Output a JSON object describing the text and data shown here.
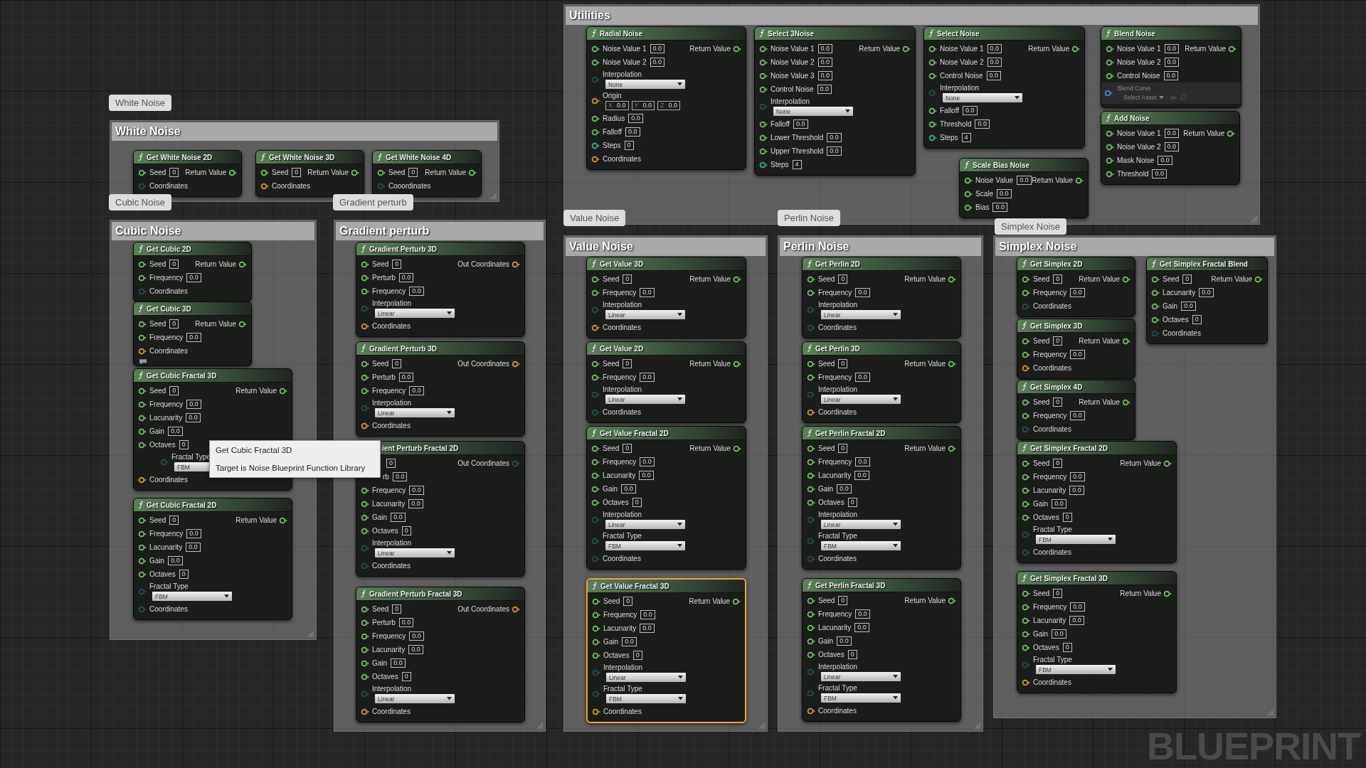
{
  "comments": [
    {
      "title": "Utilities",
      "nodes": [
        {
          "title": "Radial Noise",
          "selected": false,
          "output": {
            "label": "Return Value",
            "color": "#74c465"
          },
          "pins": [
            {
              "kind": "value",
              "label": "Noise Value 1",
              "value": "0.0",
              "color": "#74c465"
            },
            {
              "kind": "value",
              "label": "Noise Value 2",
              "value": "0.0",
              "color": "#74c465"
            },
            {
              "kind": "enum",
              "label": "Interpolation",
              "value": "None",
              "color": "#27504c"
            },
            {
              "kind": "vector",
              "label": "Origin",
              "color": "#d99a2b",
              "fields": [
                {
                  "axis": "X",
                  "value": "0.0"
                },
                {
                  "axis": "Y",
                  "value": "0.0"
                },
                {
                  "axis": "Z",
                  "value": "0.0"
                }
              ]
            },
            {
              "kind": "value",
              "label": "Radius",
              "value": "0.0",
              "color": "#74c465"
            },
            {
              "kind": "value",
              "label": "Falloff",
              "value": "0.0",
              "color": "#74c465"
            },
            {
              "kind": "value",
              "label": "Steps",
              "value": "0",
              "color": "#2fb3a3"
            },
            {
              "kind": "plain",
              "label": "Coordinates",
              "color": "#d99a2b"
            }
          ]
        },
        {
          "title": "Select 3Noise",
          "selected": false,
          "output": {
            "label": "Return Value",
            "color": "#74c465"
          },
          "pins": [
            {
              "kind": "value",
              "label": "Noise Value 1",
              "value": "0.0",
              "color": "#74c465"
            },
            {
              "kind": "value",
              "label": "Noise Value 2",
              "value": "0.0",
              "color": "#74c465"
            },
            {
              "kind": "value",
              "label": "Noise Value 3",
              "value": "0.0",
              "color": "#74c465"
            },
            {
              "kind": "value",
              "label": "Control Noise",
              "value": "0.0",
              "color": "#74c465"
            },
            {
              "kind": "enum",
              "label": "Interpolation",
              "value": "None",
              "color": "#27504c"
            },
            {
              "kind": "value",
              "label": "Falloff",
              "value": "0.0",
              "color": "#74c465"
            },
            {
              "kind": "value",
              "label": "Lower Threshold",
              "value": "0.0",
              "color": "#74c465"
            },
            {
              "kind": "value",
              "label": "Upper Threshold",
              "value": "0.0",
              "color": "#74c465"
            },
            {
              "kind": "value",
              "label": "Steps",
              "value": "4",
              "color": "#2fb3a3"
            }
          ]
        },
        {
          "title": "Select Noise",
          "selected": false,
          "output": {
            "label": "Return Value",
            "color": "#74c465"
          },
          "pins": [
            {
              "kind": "value",
              "label": "Noise Value 1",
              "value": "0.0",
              "color": "#74c465"
            },
            {
              "kind": "value",
              "label": "Noise Value 2",
              "value": "0.0",
              "color": "#74c465"
            },
            {
              "kind": "value",
              "label": "Control Noise",
              "value": "0.0",
              "color": "#74c465"
            },
            {
              "kind": "enum",
              "label": "Interpolation",
              "value": "None",
              "color": "#27504c"
            },
            {
              "kind": "value",
              "label": "Falloff",
              "value": "0.0",
              "color": "#74c465"
            },
            {
              "kind": "value",
              "label": "Threshold",
              "value": "0.0",
              "color": "#74c465"
            },
            {
              "kind": "value",
              "label": "Steps",
              "value": "4",
              "color": "#2fb3a3"
            }
          ]
        },
        {
          "title": "Blend Noise",
          "selected": false,
          "output": {
            "label": "Return Value",
            "color": "#74c465"
          },
          "pins": [
            {
              "kind": "value",
              "label": "Noise Value 1",
              "value": "0.0",
              "color": "#74c465"
            },
            {
              "kind": "value",
              "label": "Noise Value 2",
              "value": "0.0",
              "color": "#74c465"
            },
            {
              "kind": "value",
              "label": "Control Noise",
              "value": "0.0",
              "color": "#74c465"
            },
            {
              "kind": "asset",
              "label": "Blend Curve",
              "placeholder": "Select Asset",
              "color": "#3a8ee6"
            }
          ]
        },
        {
          "title": "Add Noise",
          "selected": false,
          "output": {
            "label": "Return Value",
            "color": "#74c465"
          },
          "pins": [
            {
              "kind": "value",
              "label": "Noise Value 1",
              "value": "0.0",
              "color": "#74c465"
            },
            {
              "kind": "value",
              "label": "Noise Value 2",
              "value": "0.0",
              "color": "#74c465"
            },
            {
              "kind": "value",
              "label": "Mask Noise",
              "value": "0.0",
              "color": "#74c465"
            },
            {
              "kind": "value",
              "label": "Threshold",
              "value": "0.0",
              "color": "#74c465"
            }
          ]
        },
        {
          "title": "Scale Bias Noise",
          "selected": false,
          "output": {
            "label": "Return Value",
            "color": "#74c465"
          },
          "pins": [
            {
              "kind": "value",
              "label": "Noise Value",
              "value": "0.0",
              "color": "#74c465"
            },
            {
              "kind": "value",
              "label": "Scale",
              "value": "0.0",
              "color": "#74c465"
            },
            {
              "kind": "value",
              "label": "Bias",
              "value": "0.0",
              "color": "#74c465"
            }
          ]
        }
      ]
    },
    {
      "title": "White Noise",
      "bubble": "White Noise",
      "nodes": [
        {
          "title": "Get White Noise 2D",
          "selected": false,
          "output": {
            "label": "Return Value",
            "color": "#74c465"
          },
          "pins": [
            {
              "kind": "value",
              "label": "Seed",
              "value": "0",
              "color": "#74c465"
            },
            {
              "kind": "plain",
              "label": "Coordinates",
              "color": "#27504c"
            }
          ]
        },
        {
          "title": "Get White Noise 3D",
          "selected": false,
          "output": {
            "label": "Return Value",
            "color": "#74c465"
          },
          "pins": [
            {
              "kind": "value",
              "label": "Seed",
              "value": "0",
              "color": "#74c465"
            },
            {
              "kind": "plain",
              "label": "Coordinates",
              "color": "#d99a2b"
            }
          ]
        },
        {
          "title": "Get White Noise 4D",
          "selected": false,
          "output": {
            "label": "Return Value",
            "color": "#74c465"
          },
          "pins": [
            {
              "kind": "value",
              "label": "Seed",
              "value": "0",
              "color": "#74c465"
            },
            {
              "kind": "plain",
              "label": "Cooordinates",
              "color": "#27504c"
            }
          ]
        }
      ]
    },
    {
      "title": "Cubic Noise",
      "bubble": "Cubic Noise",
      "nodes": [
        {
          "title": "Get Cubic 2D",
          "selected": false,
          "output": {
            "label": "Return Value",
            "color": "#74c465"
          },
          "pins": [
            {
              "kind": "value",
              "label": "Seed",
              "value": "0",
              "color": "#74c465"
            },
            {
              "kind": "value",
              "label": "Frequency",
              "value": "0.0",
              "color": "#74c465"
            },
            {
              "kind": "plain",
              "label": "Coordinates",
              "color": "#27504c"
            }
          ]
        },
        {
          "title": "Get Cubic 3D",
          "selected": false,
          "comment_bubble": true,
          "output": {
            "label": "Return Value",
            "color": "#74c465"
          },
          "pins": [
            {
              "kind": "value",
              "label": "Seed",
              "value": "0",
              "color": "#74c465"
            },
            {
              "kind": "value",
              "label": "Frequency",
              "value": "0.0",
              "color": "#74c465"
            },
            {
              "kind": "plain",
              "label": "Coordinates",
              "color": "#d99a2b"
            }
          ]
        },
        {
          "title": "Get Cubic Fractal 3D",
          "selected": false,
          "output": {
            "label": "Return Value",
            "color": "#74c465"
          },
          "pins": [
            {
              "kind": "value",
              "label": "Seed",
              "value": "0",
              "color": "#74c465"
            },
            {
              "kind": "value",
              "label": "Frequency",
              "value": "0.0",
              "color": "#74c465"
            },
            {
              "kind": "value",
              "label": "Lacunarity",
              "value": "0.0",
              "color": "#74c465"
            },
            {
              "kind": "value",
              "label": "Gain",
              "value": "0.0",
              "color": "#74c465"
            },
            {
              "kind": "value",
              "label": "Octaves",
              "value": "0",
              "color": "#74c465"
            },
            {
              "kind": "enum",
              "label": "Fractal Type",
              "value": "FBM",
              "color": "#27504c",
              "covered": true
            },
            {
              "kind": "plain",
              "label": "Coordinates",
              "color": "#d99a2b"
            }
          ]
        },
        {
          "title": "Get Cubic Fractal 2D",
          "selected": false,
          "output": {
            "label": "Return Value",
            "color": "#74c465"
          },
          "pins": [
            {
              "kind": "value",
              "label": "Seed",
              "value": "0",
              "color": "#74c465"
            },
            {
              "kind": "value",
              "label": "Frequency",
              "value": "0.0",
              "color": "#74c465"
            },
            {
              "kind": "value",
              "label": "Lacunarity",
              "value": "0.0",
              "color": "#74c465"
            },
            {
              "kind": "value",
              "label": "Gain",
              "value": "0.0",
              "color": "#74c465"
            },
            {
              "kind": "value",
              "label": "Octaves",
              "value": "0",
              "color": "#74c465"
            },
            {
              "kind": "enum",
              "label": "Fractal Type",
              "value": "FBM",
              "color": "#27504c"
            },
            {
              "kind": "plain",
              "label": "Coordinates",
              "color": "#27504c"
            }
          ]
        }
      ]
    },
    {
      "title": "Gradient perturb",
      "bubble": "Gradient perturb",
      "nodes": [
        {
          "title": "Gradient Perturb 3D",
          "selected": false,
          "output": {
            "label": "Out Coordinates",
            "color": "#d99a2b"
          },
          "pins": [
            {
              "kind": "value",
              "label": "Seed",
              "value": "0",
              "color": "#74c465"
            },
            {
              "kind": "value",
              "label": "Perturb",
              "value": "0.0",
              "color": "#74c465"
            },
            {
              "kind": "value",
              "label": "Frequency",
              "value": "0.0",
              "color": "#74c465"
            },
            {
              "kind": "enum",
              "label": "Interpolation",
              "value": "Linear",
              "color": "#27504c"
            },
            {
              "kind": "plain",
              "label": "Coordinates",
              "color": "#d99a2b"
            }
          ]
        },
        {
          "title": "Gradient Perturb 3D",
          "selected": false,
          "output": {
            "label": "Out Coordinates",
            "color": "#d99a2b"
          },
          "pins": [
            {
              "kind": "value",
              "label": "Seed",
              "value": "0",
              "color": "#74c465"
            },
            {
              "kind": "value",
              "label": "Perturb",
              "value": "0.0",
              "color": "#74c465"
            },
            {
              "kind": "value",
              "label": "Frequency",
              "value": "0.0",
              "color": "#74c465"
            },
            {
              "kind": "enum",
              "label": "Interpolation",
              "value": "Linear",
              "color": "#27504c"
            },
            {
              "kind": "plain",
              "label": "Coordinates",
              "color": "#d99a2b"
            }
          ]
        },
        {
          "title": "ient Perturb Fractal 2D",
          "title_covered": true,
          "selected": false,
          "output": {
            "label": "Out Coordinates",
            "color": "#27504c"
          },
          "pins": [
            {
              "kind": "value",
              "value": "0",
              "covered": true
            },
            {
              "kind": "value",
              "label": "rb",
              "value": "0.0",
              "covered": true
            },
            {
              "kind": "value",
              "label": "Frequency",
              "value": "0.0",
              "color": "#74c465"
            },
            {
              "kind": "value",
              "label": "Lacunarity",
              "value": "0.0",
              "color": "#74c465"
            },
            {
              "kind": "value",
              "label": "Gain",
              "value": "0.0",
              "color": "#74c465"
            },
            {
              "kind": "value",
              "label": "Octaves",
              "value": "0",
              "color": "#74c465"
            },
            {
              "kind": "enum",
              "label": "Interpolation",
              "value": "Linear",
              "color": "#27504c"
            },
            {
              "kind": "plain",
              "label": "Coordinates",
              "color": "#27504c"
            }
          ]
        },
        {
          "title": "Gradient Perturb Fractal 3D",
          "selected": false,
          "output": {
            "label": "Out Coordinates",
            "color": "#d99a2b"
          },
          "pins": [
            {
              "kind": "value",
              "label": "Seed",
              "value": "0",
              "color": "#74c465"
            },
            {
              "kind": "value",
              "label": "Perturb",
              "value": "0.0",
              "color": "#74c465"
            },
            {
              "kind": "value",
              "label": "Frequency",
              "value": "0.0",
              "color": "#74c465"
            },
            {
              "kind": "value",
              "label": "Lacunarity",
              "value": "0.0",
              "color": "#74c465"
            },
            {
              "kind": "value",
              "label": "Gain",
              "value": "0.0",
              "color": "#74c465"
            },
            {
              "kind": "value",
              "label": "Octaves",
              "value": "0",
              "color": "#74c465"
            },
            {
              "kind": "enum",
              "label": "Interpolation",
              "value": "Linear",
              "color": "#27504c"
            },
            {
              "kind": "plain",
              "label": "Coordinates",
              "color": "#d99a2b"
            }
          ]
        }
      ]
    },
    {
      "title": "Value Noise",
      "bubble": "Value Noise",
      "nodes": [
        {
          "title": "Get Value 3D",
          "selected": false,
          "output": {
            "label": "Return Value",
            "color": "#74c465"
          },
          "pins": [
            {
              "kind": "value",
              "label": "Seed",
              "value": "0",
              "color": "#74c465"
            },
            {
              "kind": "value",
              "label": "Frequency",
              "value": "0.0",
              "color": "#74c465"
            },
            {
              "kind": "enum",
              "label": "Interpolation",
              "value": "Linear",
              "color": "#27504c"
            },
            {
              "kind": "plain",
              "label": "Coordinates",
              "color": "#d99a2b"
            }
          ]
        },
        {
          "title": "Get Value 2D",
          "selected": false,
          "output": {
            "label": "Return Value",
            "color": "#74c465"
          },
          "pins": [
            {
              "kind": "value",
              "label": "Seed",
              "value": "0",
              "color": "#74c465"
            },
            {
              "kind": "value",
              "label": "Frequency",
              "value": "0.0",
              "color": "#74c465"
            },
            {
              "kind": "enum",
              "label": "Interpolation",
              "value": "Linear",
              "color": "#27504c"
            },
            {
              "kind": "plain",
              "label": "Coordinates",
              "color": "#27504c"
            }
          ]
        },
        {
          "title": "Get Value Fractal 2D",
          "selected": false,
          "output": {
            "label": "Return Value",
            "color": "#74c465"
          },
          "pins": [
            {
              "kind": "value",
              "label": "Seed",
              "value": "0",
              "color": "#74c465"
            },
            {
              "kind": "value",
              "label": "Frequency",
              "value": "0.0",
              "color": "#74c465"
            },
            {
              "kind": "value",
              "label": "Lacunarity",
              "value": "0.0",
              "color": "#74c465"
            },
            {
              "kind": "value",
              "label": "Gain",
              "value": "0.0",
              "color": "#74c465"
            },
            {
              "kind": "value",
              "label": "Octaves",
              "value": "0",
              "color": "#74c465"
            },
            {
              "kind": "enum",
              "label": "Interpolation",
              "value": "Linear",
              "color": "#27504c"
            },
            {
              "kind": "enum",
              "label": "Fractal Type",
              "value": "FBM",
              "color": "#27504c"
            },
            {
              "kind": "plain",
              "label": "Coordinates",
              "color": "#27504c"
            }
          ]
        },
        {
          "title": "Get Value Fractal 3D",
          "selected": true,
          "output": {
            "label": "Return Value",
            "color": "#74c465"
          },
          "pins": [
            {
              "kind": "value",
              "label": "Seed",
              "value": "0",
              "color": "#74c465"
            },
            {
              "kind": "value",
              "label": "Frequency",
              "value": "0.0",
              "color": "#74c465"
            },
            {
              "kind": "value",
              "label": "Lacunarity",
              "value": "0.0",
              "color": "#74c465"
            },
            {
              "kind": "value",
              "label": "Gain",
              "value": "0.0",
              "color": "#74c465"
            },
            {
              "kind": "value",
              "label": "Octaves",
              "value": "0",
              "color": "#74c465"
            },
            {
              "kind": "enum",
              "label": "Interpolation",
              "value": "Linear",
              "color": "#27504c"
            },
            {
              "kind": "enum",
              "label": "Fractal Type",
              "value": "FBM",
              "color": "#27504c"
            },
            {
              "kind": "plain",
              "label": "Coordinates",
              "color": "#d99a2b"
            }
          ]
        }
      ]
    },
    {
      "title": "Perlin Noise",
      "bubble": "Perlin Noise",
      "nodes": [
        {
          "title": "Get Perlin 2D",
          "selected": false,
          "output": {
            "label": "Return Value",
            "color": "#74c465"
          },
          "pins": [
            {
              "kind": "value",
              "label": "Seed",
              "value": "0",
              "color": "#74c465"
            },
            {
              "kind": "value",
              "label": "Frequency",
              "value": "0.0",
              "color": "#74c465"
            },
            {
              "kind": "enum",
              "label": "Interpolation",
              "value": "Linear",
              "color": "#27504c"
            },
            {
              "kind": "plain",
              "label": "Coordinates",
              "color": "#27504c"
            }
          ]
        },
        {
          "title": "Get Perlin 3D",
          "selected": false,
          "output": {
            "label": "Return Value",
            "color": "#74c465"
          },
          "pins": [
            {
              "kind": "value",
              "label": "Seed",
              "value": "0",
              "color": "#74c465"
            },
            {
              "kind": "value",
              "label": "Frequency",
              "value": "0.0",
              "color": "#74c465"
            },
            {
              "kind": "enum",
              "label": "Interpolation",
              "value": "Linear",
              "color": "#27504c"
            },
            {
              "kind": "plain",
              "label": "Coordinates",
              "color": "#d99a2b"
            }
          ]
        },
        {
          "title": "Get Perlin Fractal 2D",
          "selected": false,
          "output": {
            "label": "Return Value",
            "color": "#74c465"
          },
          "pins": [
            {
              "kind": "value",
              "label": "Seed",
              "value": "0",
              "color": "#74c465"
            },
            {
              "kind": "value",
              "label": "Frequency",
              "value": "0.0",
              "color": "#74c465"
            },
            {
              "kind": "value",
              "label": "Lacunarity",
              "value": "0.0",
              "color": "#74c465"
            },
            {
              "kind": "value",
              "label": "Gain",
              "value": "0.0",
              "color": "#74c465"
            },
            {
              "kind": "value",
              "label": "Octaves",
              "value": "0",
              "color": "#74c465"
            },
            {
              "kind": "enum",
              "label": "Interpolation",
              "value": "Linear",
              "color": "#27504c"
            },
            {
              "kind": "enum",
              "label": "Fractal Type",
              "value": "FBM",
              "color": "#27504c"
            },
            {
              "kind": "plain",
              "label": "Coordinates",
              "color": "#27504c"
            }
          ]
        },
        {
          "title": "Get Perlin Fractal 3D",
          "selected": false,
          "output": {
            "label": "Return Value",
            "color": "#74c465"
          },
          "pins": [
            {
              "kind": "value",
              "label": "Seed",
              "value": "0",
              "color": "#74c465"
            },
            {
              "kind": "value",
              "label": "Frequency",
              "value": "0.0",
              "color": "#74c465"
            },
            {
              "kind": "value",
              "label": "Lacunarity",
              "value": "0.0",
              "color": "#74c465"
            },
            {
              "kind": "value",
              "label": "Gain",
              "value": "0.0",
              "color": "#74c465"
            },
            {
              "kind": "value",
              "label": "Octaves",
              "value": "0",
              "color": "#74c465"
            },
            {
              "kind": "enum",
              "label": "Interpolation",
              "value": "Linear",
              "color": "#27504c"
            },
            {
              "kind": "enum",
              "label": "Fractal Type",
              "value": "FBM",
              "color": "#27504c"
            },
            {
              "kind": "plain",
              "label": "Coordinates",
              "color": "#d99a2b"
            }
          ]
        }
      ]
    },
    {
      "title": "Simplex Noise",
      "bubble": "Simplex Noise",
      "nodes": [
        {
          "title": "Get Simplex 2D",
          "selected": false,
          "output": {
            "label": "Return Value",
            "color": "#74c465"
          },
          "pins": [
            {
              "kind": "value",
              "label": "Seed",
              "value": "0",
              "color": "#74c465"
            },
            {
              "kind": "value",
              "label": "Frequency",
              "value": "0.0",
              "color": "#74c465"
            },
            {
              "kind": "plain",
              "label": "Coordinates",
              "color": "#27504c"
            }
          ]
        },
        {
          "title": "Get Simplex 3D",
          "selected": false,
          "output": {
            "label": "Return Value",
            "color": "#74c465"
          },
          "pins": [
            {
              "kind": "value",
              "label": "Seed",
              "value": "0",
              "color": "#74c465"
            },
            {
              "kind": "value",
              "label": "Frequency",
              "value": "0.0",
              "color": "#74c465"
            },
            {
              "kind": "plain",
              "label": "Coordinates",
              "color": "#d99a2b"
            }
          ]
        },
        {
          "title": "Get Simplex 4D",
          "selected": false,
          "output": {
            "label": "Return Value",
            "color": "#74c465"
          },
          "pins": [
            {
              "kind": "value",
              "label": "Seed",
              "value": "0",
              "color": "#74c465"
            },
            {
              "kind": "value",
              "label": "Frequency",
              "value": "0.0",
              "color": "#74c465"
            },
            {
              "kind": "plain",
              "label": "Coordinates",
              "color": "#27504c"
            }
          ]
        },
        {
          "title": "Get Simplex Fractal 2D",
          "selected": false,
          "output": {
            "label": "Return Value",
            "color": "#74c465"
          },
          "pins": [
            {
              "kind": "value",
              "label": "Seed",
              "value": "0",
              "color": "#74c465"
            },
            {
              "kind": "value",
              "label": "Frequency",
              "value": "0.0",
              "color": "#74c465"
            },
            {
              "kind": "value",
              "label": "Lacunarity",
              "value": "0.0",
              "color": "#74c465"
            },
            {
              "kind": "value",
              "label": "Gain",
              "value": "0.0",
              "color": "#74c465"
            },
            {
              "kind": "value",
              "label": "Octaves",
              "value": "0",
              "color": "#74c465"
            },
            {
              "kind": "enum",
              "label": "Fractal Type",
              "value": "FBM",
              "color": "#27504c"
            },
            {
              "kind": "plain",
              "label": "Coordinates",
              "color": "#27504c"
            }
          ]
        },
        {
          "title": "Get Simplex Fractal 3D",
          "selected": false,
          "output": {
            "label": "Return Value",
            "color": "#74c465"
          },
          "pins": [
            {
              "kind": "value",
              "label": "Seed",
              "value": "0",
              "color": "#74c465"
            },
            {
              "kind": "value",
              "label": "Frequency",
              "value": "0.0",
              "color": "#74c465"
            },
            {
              "kind": "value",
              "label": "Lacunarity",
              "value": "0.0",
              "color": "#74c465"
            },
            {
              "kind": "value",
              "label": "Gain",
              "value": "0.0",
              "color": "#74c465"
            },
            {
              "kind": "value",
              "label": "Octaves",
              "value": "0",
              "color": "#74c465"
            },
            {
              "kind": "enum",
              "label": "Fractal Type",
              "value": "FBM",
              "color": "#27504c"
            },
            {
              "kind": "plain",
              "label": "Coordinates",
              "color": "#d99a2b"
            }
          ]
        },
        {
          "title": "Get Simplex Fractal Blend",
          "selected": false,
          "output": {
            "label": "Return Value",
            "color": "#74c465"
          },
          "pins": [
            {
              "kind": "value",
              "label": "Seed",
              "value": "0",
              "color": "#74c465"
            },
            {
              "kind": "value",
              "label": "Lacunarity",
              "value": "0.0",
              "color": "#74c465"
            },
            {
              "kind": "value",
              "label": "Gain",
              "value": "0.0",
              "color": "#74c465"
            },
            {
              "kind": "value",
              "label": "Octaves",
              "value": "0",
              "color": "#74c465"
            },
            {
              "kind": "plain",
              "label": "Coordinates",
              "color": "#27504c"
            }
          ]
        }
      ]
    }
  ],
  "tooltip": {
    "title": "Get Cubic Fractal 3D",
    "text": "Target is Noise Blueprint Function Library"
  },
  "graph_type": "BLUEPRINT"
}
